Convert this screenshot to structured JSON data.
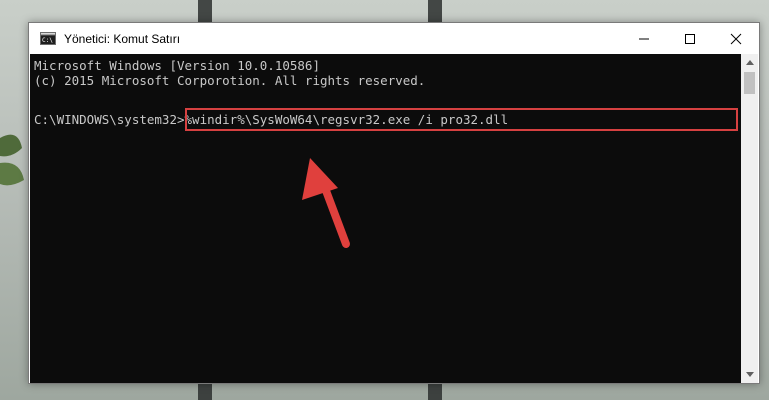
{
  "window": {
    "title": "Yönetici: Komut Satırı",
    "controls": [
      "minimize",
      "maximize",
      "close"
    ]
  },
  "console": {
    "lines": [
      "Microsoft Windows [Version 10.0.10586]",
      "(c) 2015 Microsoft Corporotion. All rights reserved."
    ],
    "prompt": "C:\\WINDOWS\\system32>",
    "command": "%windir%\\SysWoW64\\regsvr32.exe /i pro32.dll"
  },
  "colors": {
    "console_bg": "#0c0c0c",
    "console_text": "#c8c8c8",
    "highlight": "#d64141",
    "arrow": "#e0403d"
  },
  "icons": {
    "title": "cmd-icon",
    "arrow": "pointer-arrow"
  }
}
